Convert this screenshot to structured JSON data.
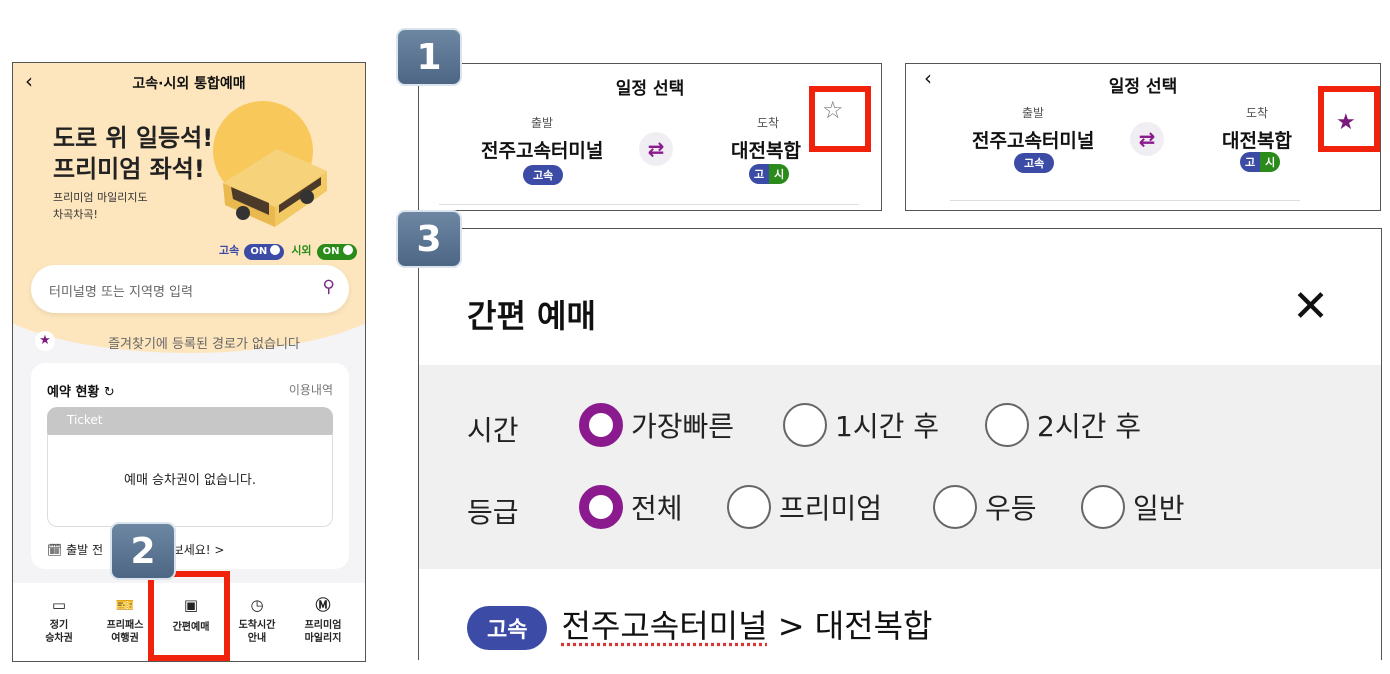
{
  "phone": {
    "title": "고속·시외 통합예매",
    "hero_line1": "도로 위 일등석!",
    "hero_line2": "프리미엄 좌석!",
    "hero_sub1": "프리미엄 마일리지도",
    "hero_sub2": "차곡차곡!",
    "toggle_express_label": "고속",
    "toggle_express_state": "ON",
    "toggle_intercity_label": "시외",
    "toggle_intercity_state": "ON",
    "search_placeholder": "터미널명 또는 지역명 입력",
    "favorites_empty": "즐겨찾기에 등록된 경로가 없습니다",
    "reservation_title": "예약 현황",
    "reservation_link": "이용내역",
    "ticket_label": "Ticket",
    "ticket_empty": "예매 승차권이 없습니다.",
    "reservation_footer_start": "출발 전",
    "reservation_footer_end": "보세요! >",
    "nav": [
      {
        "line1": "정기",
        "line2": "승차권"
      },
      {
        "line1": "프리패스",
        "line2": "여행권"
      },
      {
        "line1": "간편예매",
        "line2": ""
      },
      {
        "line1": "도착시간",
        "line2": "안내"
      },
      {
        "line1": "프리미엄",
        "line2": "마일리지"
      }
    ]
  },
  "steps": {
    "s1": "1",
    "s2": "2",
    "s3": "3"
  },
  "schedule": {
    "title": "일정 선택",
    "depart_label": "출발",
    "arrive_label": "도착",
    "depart_terminal": "전주고속터미널",
    "arrive_terminal": "대전복합",
    "depart_badge": "고속",
    "arrive_badge_a": "고",
    "arrive_badge_b": "시",
    "swap_icon": "⇄",
    "star_empty": "☆",
    "star_filled": "★"
  },
  "quick": {
    "title": "간편 예매",
    "close": "✕",
    "time_label": "시간",
    "time_options": [
      "가장빠른",
      "1시간 후",
      "2시간 후"
    ],
    "grade_label": "등급",
    "grade_options": [
      "전체",
      "프리미엄",
      "우등",
      "일반"
    ],
    "route_badge": "고속",
    "route_from": "전주고속터미널",
    "route_sep": " > ",
    "route_to": "대전복합"
  },
  "colors": {
    "accent_purple": "#8a1a8d",
    "express_blue": "#3b4ba6",
    "intercity_green": "#2a8a1a",
    "highlight_red": "#f0220c",
    "hero_bg": "#fde6bd"
  }
}
